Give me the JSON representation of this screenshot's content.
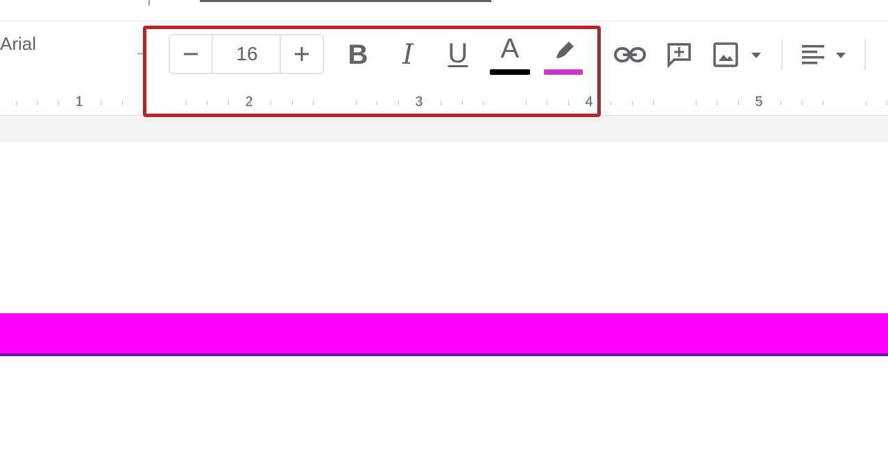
{
  "toolbar": {
    "font_name": "Arial",
    "font_size": {
      "value": "16",
      "decrease_label": "−",
      "increase_label": "+"
    },
    "formatting": {
      "bold_label": "B",
      "italic_label": "I",
      "underline_label": "U",
      "text_color_label": "A"
    },
    "text_color": "#000000",
    "highlight_color": "#c63ac6",
    "icons": [
      "minus-icon",
      "plus-icon",
      "bold-icon",
      "italic-icon",
      "underline-icon",
      "text-color-icon",
      "highlighter-icon",
      "link-icon",
      "add-comment-icon",
      "insert-image-icon",
      "align-left-icon",
      "chevron-down-icon"
    ]
  },
  "ruler": {
    "labels": [
      "1",
      "2",
      "3",
      "4",
      "5"
    ]
  },
  "document": {
    "highlight_strip_color": "#ff00ff"
  },
  "annotation": {
    "focus_box_color": "#b3262a"
  }
}
